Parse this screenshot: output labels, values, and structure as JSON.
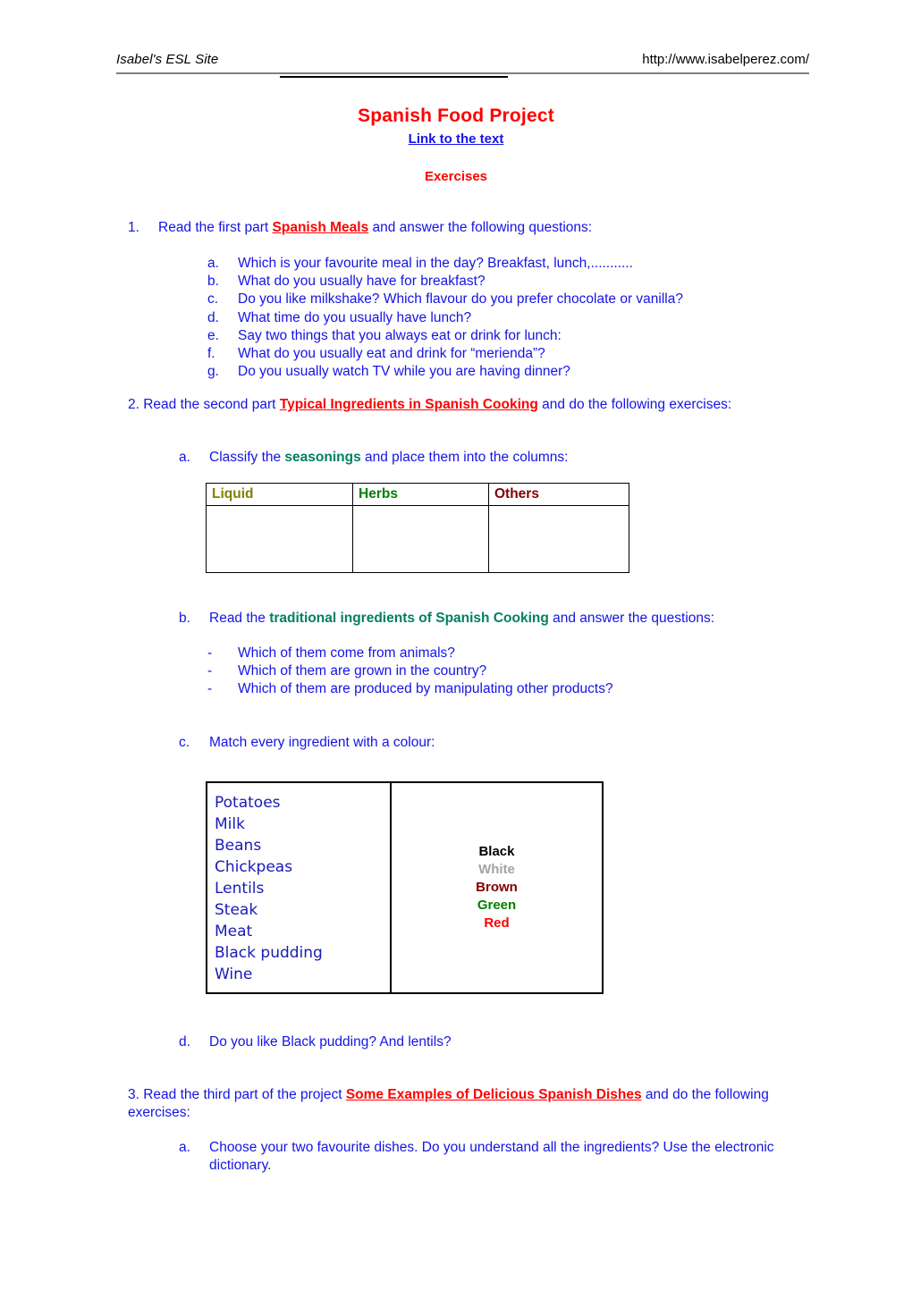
{
  "header": {
    "site_name": "Isabel's ESL Site",
    "url": "http://www.isabelperez.com/"
  },
  "title_block": {
    "title": "Spanish Food Project",
    "link_label": "Link to the text",
    "subtitle": "Exercises"
  },
  "section1": {
    "marker": "1.",
    "text_before": "Read the first part ",
    "highlight": "Spanish Meals",
    "text_after": " and answer the following questions:",
    "questions": [
      {
        "marker": "a.",
        "text": "Which is your favourite meal in the day? Breakfast, lunch,..........."
      },
      {
        "marker": "b.",
        "text": "What do you usually have for breakfast?"
      },
      {
        "marker": "c.",
        "text": "Do you like milkshake? Which flavour do you prefer chocolate or vanilla?"
      },
      {
        "marker": "d.",
        "text": "What time do you usually have lunch?"
      },
      {
        "marker": "e.",
        "text": "Say two things that you always eat or drink for lunch:"
      },
      {
        "marker": "f.",
        "text": "What do you usually eat and drink for “merienda”?"
      },
      {
        "marker": "g.",
        "text": "Do you usually watch TV while you are having dinner?"
      }
    ]
  },
  "section2": {
    "text_before": "2. Read the second part ",
    "highlight": "Typical Ingredients in Spanish Cooking",
    "text_after": " and do the following exercises:",
    "task_a": {
      "marker": "a.",
      "text_before": "Classify the ",
      "highlight": "seasonings",
      "text_after": " and place them into the columns:"
    },
    "table": {
      "headers": [
        "Liquid",
        "Herbs",
        "Others"
      ],
      "rows": [
        [
          "",
          "",
          ""
        ]
      ]
    },
    "task_b": {
      "marker": "b.",
      "text_before": "Read the ",
      "highlight": "traditional ingredients of Spanish Cooking",
      "text_after": " and answer the questions:",
      "bullets": [
        {
          "marker": "-",
          "text": "Which of them come from animals?"
        },
        {
          "marker": "-",
          "text": "Which of them are grown in the country?"
        },
        {
          "marker": "-",
          "text": "Which of them are produced by manipulating other products?"
        }
      ]
    },
    "task_c": {
      "marker": "c.",
      "text": "Match every ingredient with a colour:",
      "ingredients": [
        "Potatoes",
        "Milk",
        "Beans",
        "Chickpeas",
        "Lentils",
        "Steak",
        "Meat",
        "Black pudding",
        "Wine"
      ],
      "colours": [
        {
          "label": "Black",
          "hex": "#000000"
        },
        {
          "label": "White",
          "hex": "#a3a3a3"
        },
        {
          "label": "Brown",
          "hex": "#800000"
        },
        {
          "label": "Green",
          "hex": "#008000"
        },
        {
          "label": "Red",
          "hex": "#ff0000"
        }
      ]
    },
    "task_d": {
      "marker": "d.",
      "text": "Do you like Black pudding? And lentils?"
    }
  },
  "section3": {
    "text_before": "3. Read the third part of the project ",
    "highlight": "Some Examples of Delicious Spanish Dishes",
    "text_after": " and do the following exercises:",
    "task_a": {
      "marker": "a.",
      "text": "Choose your two favourite dishes. Do you understand all the ingredients? Use the electronic dictionary."
    }
  },
  "theme": {
    "body_blue": "#1414e6",
    "accent_red": "#ff0000",
    "accent_green": "#008060",
    "olive": "#808000"
  }
}
